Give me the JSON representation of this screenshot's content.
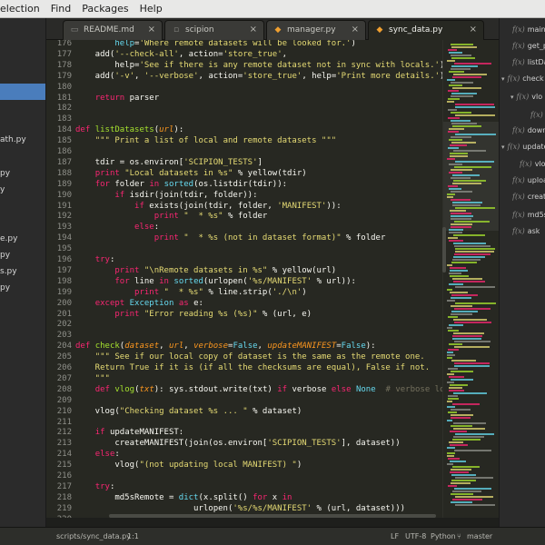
{
  "menu": [
    "election",
    "Find",
    "Packages",
    "Help"
  ],
  "left_sidebar": {
    "items": [
      {
        "label": "",
        "selected": true
      },
      {
        "label": "ath.py",
        "selected": false
      },
      {
        "label": "py",
        "selected": false
      },
      {
        "label": "y",
        "selected": false
      },
      {
        "label": "e.py",
        "selected": false
      },
      {
        "label": "py",
        "selected": false
      },
      {
        "label": "s.py",
        "selected": false
      },
      {
        "label": "py",
        "selected": false
      }
    ]
  },
  "tabs": [
    {
      "label": "README.md",
      "icon": "markdown-icon",
      "active": false
    },
    {
      "label": "scipion",
      "icon": "file-icon",
      "active": false
    },
    {
      "label": "manager.py",
      "icon": "python-file-icon",
      "active": false
    },
    {
      "label": "sync_data.py",
      "icon": "python-file-icon",
      "active": true
    }
  ],
  "editor": {
    "lines": [
      {
        "n": "176",
        "html": "        <span class=\"b\">help</span>=<span class=\"s\">'Where remote datasets will be looked for.'</span>)"
      },
      {
        "n": "177",
        "html": "    add(<span class=\"s\">'--check-all'</span>, action=<span class=\"s\">'store_true'</span>,"
      },
      {
        "n": "178",
        "html": "        help=<span class=\"s\">'See if there is any remote dataset not in sync with locals.'</span>)"
      },
      {
        "n": "179",
        "html": "    add(<span class=\"s\">'-v'</span>, <span class=\"s\">'--verbose'</span>, action=<span class=\"s\">'store_true'</span>, help=<span class=\"s\">'Print more details.'</span>)"
      },
      {
        "n": "180",
        "html": ""
      },
      {
        "n": "181",
        "html": "    <span class=\"k\">return</span> parser"
      },
      {
        "n": "182",
        "html": ""
      },
      {
        "n": "183",
        "html": ""
      },
      {
        "n": "184",
        "html": "<span class=\"k\">def</span> <span class=\"f\">listDatasets</span>(<span class=\"pa\">url</span>):"
      },
      {
        "n": "185",
        "html": "    <span class=\"s\">\"\"\" Print a list of local and remote datasets \"\"\"</span>"
      },
      {
        "n": "186",
        "html": ""
      },
      {
        "n": "187",
        "html": "    tdir = os.environ[<span class=\"s\">'SCIPION_TESTS'</span>]"
      },
      {
        "n": "188",
        "html": "    <span class=\"k\">print</span> <span class=\"s\">\"Local datasets in %s\"</span> % yellow(tdir)"
      },
      {
        "n": "189",
        "html": "    <span class=\"k\">for</span> folder <span class=\"k\">in</span> <span class=\"b\">sorted</span>(os.listdir(tdir)):"
      },
      {
        "n": "190",
        "html": "        <span class=\"k\">if</span> isdir(join(tdir, folder)):"
      },
      {
        "n": "191",
        "html": "            <span class=\"k\">if</span> exists(join(tdir, folder, <span class=\"s\">'MANIFEST'</span>)):"
      },
      {
        "n": "192",
        "html": "                <span class=\"k\">print</span> <span class=\"s\">\"  * %s\"</span> % folder"
      },
      {
        "n": "193",
        "html": "            <span class=\"k\">else</span>:"
      },
      {
        "n": "194",
        "html": "                <span class=\"k\">print</span> <span class=\"s\">\"  * %s (not in dataset format)\"</span> % folder"
      },
      {
        "n": "195",
        "html": ""
      },
      {
        "n": "196",
        "html": "    <span class=\"k\">try</span>:"
      },
      {
        "n": "197",
        "html": "        <span class=\"k\">print</span> <span class=\"s\">\"\\nRemote datasets in %s\"</span> % yellow(url)"
      },
      {
        "n": "198",
        "html": "        <span class=\"k\">for</span> line <span class=\"k\">in</span> <span class=\"b\">sorted</span>(urlopen(<span class=\"s\">'%s/MANIFEST'</span> % url)):"
      },
      {
        "n": "199",
        "html": "            <span class=\"k\">print</span> <span class=\"s\">\"  * %s\"</span> % line.strip(<span class=\"s\">'./\\n'</span>)"
      },
      {
        "n": "200",
        "html": "    <span class=\"k\">except</span> <span class=\"b\">Exception</span> <span class=\"k\">as</span> e:"
      },
      {
        "n": "201",
        "html": "        <span class=\"k\">print</span> <span class=\"s\">\"Error reading %s (%s)\"</span> % (url, e)"
      },
      {
        "n": "202",
        "html": ""
      },
      {
        "n": "203",
        "html": ""
      },
      {
        "n": "204",
        "html": "<span class=\"k\">def</span> <span class=\"f\">check</span>(<span class=\"pa\">dataset</span>, <span class=\"pa\">url</span>, <span class=\"pa\">verbose</span>=<span class=\"b\">False</span>, <span class=\"pa\">updateMANIFEST</span>=<span class=\"b\">False</span>):"
      },
      {
        "n": "205",
        "html": "    <span class=\"s\">\"\"\" See if our local copy of dataset is the same as the remote one.</span>"
      },
      {
        "n": "206",
        "html": "<span class=\"s\">    Return True if it is (if all the checksums are equal), False if not.</span>"
      },
      {
        "n": "207",
        "html": "<span class=\"s\">    \"\"\"</span>"
      },
      {
        "n": "208",
        "html": "    <span class=\"k\">def</span> <span class=\"f\">vlog</span>(<span class=\"pa\">txt</span>): sys.stdout.write(txt) <span class=\"k\">if</span> verbose <span class=\"k\">else</span> <span class=\"b\">None</span>  <span class=\"c\"># verbose log</span>"
      },
      {
        "n": "209",
        "html": ""
      },
      {
        "n": "210",
        "html": "    vlog(<span class=\"s\">\"Checking dataset %s ... \"</span> % dataset)"
      },
      {
        "n": "211",
        "html": ""
      },
      {
        "n": "212",
        "html": "    <span class=\"k\">if</span> updateMANIFEST:"
      },
      {
        "n": "213",
        "html": "        createMANIFEST(join(os.environ[<span class=\"s\">'SCIPION_TESTS'</span>], dataset))"
      },
      {
        "n": "214",
        "html": "    <span class=\"k\">else</span>:"
      },
      {
        "n": "215",
        "html": "        vlog(<span class=\"s\">\"(not updating local MANIFEST) \"</span>)"
      },
      {
        "n": "216",
        "html": ""
      },
      {
        "n": "217",
        "html": "    <span class=\"k\">try</span>:"
      },
      {
        "n": "218",
        "html": "        md5sRemote = <span class=\"b\">dict</span>(x.split() <span class=\"k\">for</span> x <span class=\"k\">in</span>"
      },
      {
        "n": "219",
        "html": "                        urlopen(<span class=\"s\">'%s/%s/MANIFEST'</span> % (url, dataset)))"
      },
      {
        "n": "220",
        "html": ""
      },
      {
        "n": "221",
        "html": "        md5sLocal = <span class=\"b\">dict</span>(x.split() <span class=\"k\">for</span> x <span class=\"k\">in</span>"
      },
      {
        "n": "222",
        "html": "                       open(<span class=\"s\">'%s/MANIFEST'</span> %"
      }
    ]
  },
  "symbols": [
    {
      "label": "main",
      "kind": "function",
      "expander": ""
    },
    {
      "label": "get_pa",
      "kind": "function",
      "expander": ""
    },
    {
      "label": "listData",
      "kind": "function",
      "expander": ""
    },
    {
      "label": "check",
      "kind": "function",
      "expander": "▾"
    },
    {
      "label": "vlo",
      "kind": "function",
      "expander": "▾"
    },
    {
      "label": "",
      "kind": "function",
      "expander": ""
    },
    {
      "label": "downl",
      "kind": "function",
      "expander": ""
    },
    {
      "label": "update",
      "kind": "function",
      "expander": "▾"
    },
    {
      "label": "vlo",
      "kind": "function",
      "expander": ""
    },
    {
      "label": "upload",
      "kind": "function",
      "expander": ""
    },
    {
      "label": "create",
      "kind": "function",
      "expander": ""
    },
    {
      "label": "md5su",
      "kind": "function",
      "expander": ""
    },
    {
      "label": "ask",
      "kind": "function",
      "expander": ""
    }
  ],
  "status": {
    "path": "scripts/sync_data.py",
    "cursor": "1:1",
    "line_ending": "LF",
    "encoding": "UTF-8",
    "grammar": "Python",
    "branch": "master"
  },
  "colors": {
    "editor_bg": "#272822",
    "keyword": "#f92672",
    "string": "#e6db74",
    "function": "#a6e22e",
    "builtin": "#66d9ef",
    "selection": "#4a7dbc"
  }
}
